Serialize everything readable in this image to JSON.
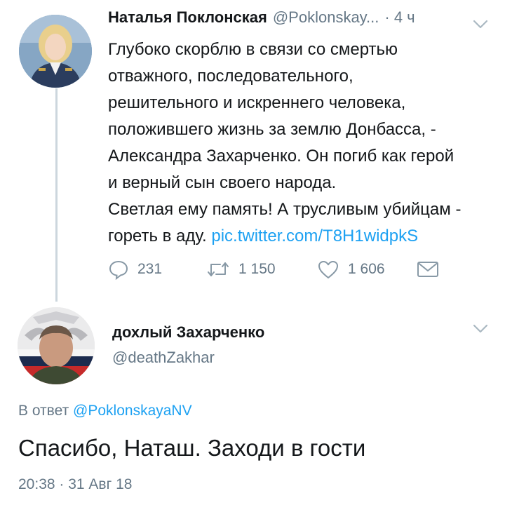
{
  "tweet1": {
    "name": "Наталья Поклонская",
    "handle": "@Poklonskay...",
    "time": "· 4 ч",
    "lines": [
      "Глубоко скорблю в связи со смертью",
      "отважного, последовательного,",
      "решительного и искреннего человека,",
      "положившего жизнь за землю Донбасса, -",
      "Александра Захарченко. Он погиб как герой",
      "и верный сын своего народа.",
      "Светлая ему память! А трусливым убийцам -"
    ],
    "last_line_text": "гореть в аду.",
    "link": "pic.twitter.com/T8H1widpkS",
    "replies": "231",
    "retweets": "1 150",
    "likes": "1 606"
  },
  "tweet2": {
    "name": "дохлый Захарченко",
    "handle": "@deathZakhar",
    "reply_prefix": "В ответ",
    "reply_mention": "@PoklonskayaNV",
    "text": "Спасибо, Наташ. Заходи в гости",
    "timestamp": "20:38 · 31 Авг 18"
  },
  "icons": {
    "reply": "reply-icon",
    "retweet": "retweet-icon",
    "like": "heart-icon",
    "dm": "envelope-icon",
    "more": "chevron-down-icon"
  },
  "colors": {
    "link": "#1da1f2",
    "secondary": "#657786",
    "text": "#14171a",
    "thread_line": "#ccd6dd"
  }
}
